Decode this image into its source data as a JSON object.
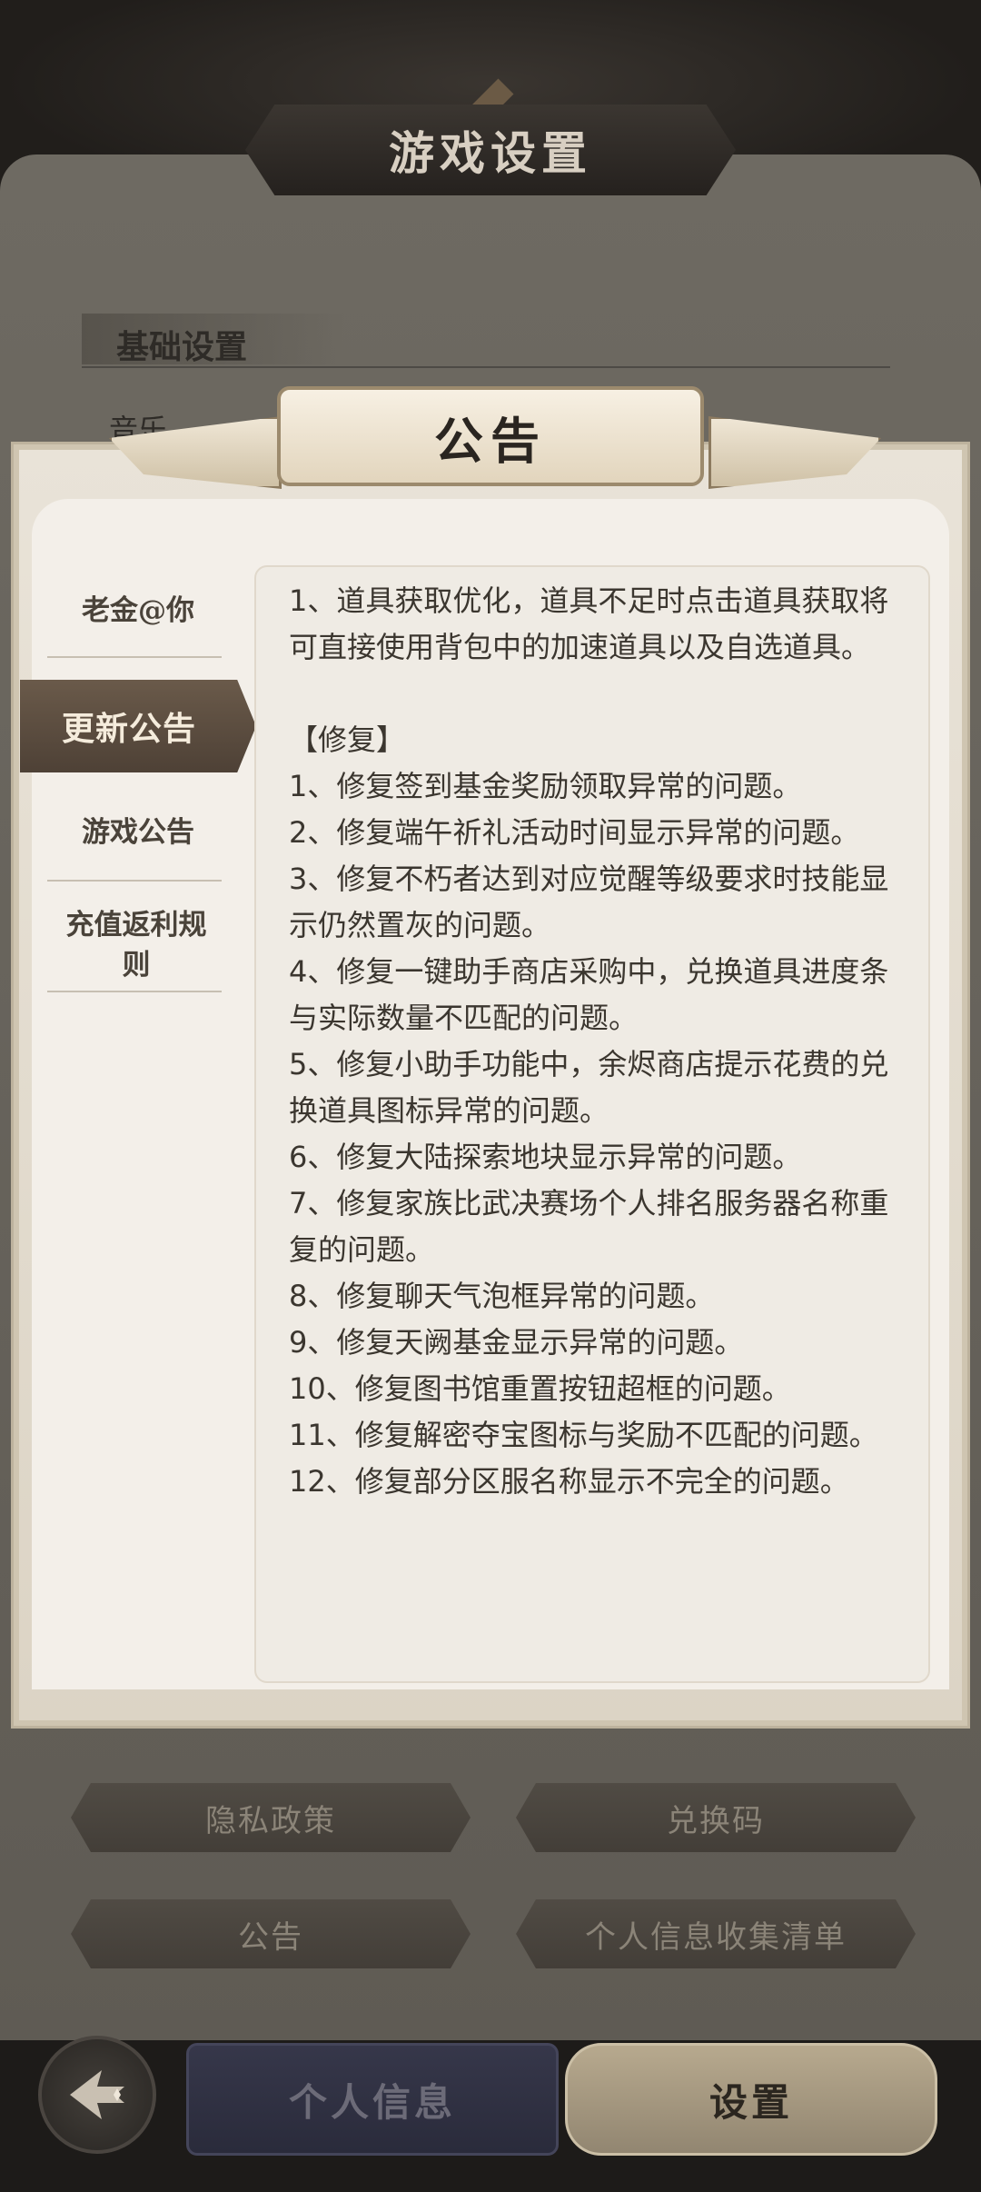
{
  "background": {
    "title": "游戏设置",
    "section_header": "基础设置",
    "partial_item": "音乐",
    "buttons": {
      "privacy": "隐私政策",
      "redeem": "兑换码",
      "announcement": "公告",
      "personal_info_list": "个人信息收集清单"
    },
    "bottom_tabs": {
      "profile": "个人信息",
      "settings": "设置"
    }
  },
  "modal": {
    "title": "公告",
    "nav": [
      {
        "label": "老金@你"
      },
      {
        "label": "更新公告",
        "active": true
      },
      {
        "label": "游戏公告"
      },
      {
        "label": "充值返利规则"
      }
    ],
    "content_lines": [
      "1、道具获取优化，道具不足时点击道具获取将可直接使用背包中的加速道具以及自选道具。",
      "",
      "【修复】",
      "1、修复签到基金奖励领取异常的问题。",
      "2、修复端午祈礼活动时间显示异常的问题。",
      "3、修复不朽者达到对应觉醒等级要求时技能显示仍然置灰的问题。",
      "4、修复一键助手商店采购中，兑换道具进度条与实际数量不匹配的问题。",
      "5、修复小助手功能中，余烬商店提示花费的兑换道具图标异常的问题。",
      "6、修复大陆探索地块显示异常的问题。",
      "7、修复家族比武决赛场个人排名服务器名称重复的问题。",
      "8、修复聊天气泡框异常的问题。",
      "9、修复天阙基金显示异常的问题。",
      "10、修复图书馆重置按钮超框的问题。",
      "11、修复解密夺宝图标与奖励不匹配的问题。",
      "12、修复部分区服名称显示不完全的问题。"
    ]
  }
}
